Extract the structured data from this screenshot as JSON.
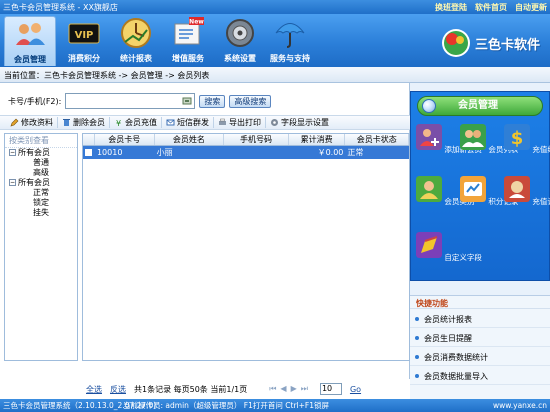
{
  "titlebar": {
    "title": "三色卡会员管理系统 - XX旗舰店",
    "links": [
      "换班登陆",
      "软件首页",
      "自动更新"
    ]
  },
  "toolbar": {
    "buttons": [
      {
        "label": "会员管理",
        "icon": "members-icon"
      },
      {
        "label": "消费积分",
        "icon": "vip-card-icon"
      },
      {
        "label": "统计报表",
        "icon": "report-clock-icon"
      },
      {
        "label": "增值服务",
        "icon": "new-service-icon"
      },
      {
        "label": "系统设置",
        "icon": "settings-icon"
      },
      {
        "label": "服务与支持",
        "icon": "umbrella-icon"
      }
    ],
    "brand": "三色卡软件"
  },
  "breadcrumb": "当前位置：三色卡会员管理系统 -> 会员管理 -> 会员列表",
  "search": {
    "label": "卡号/手机(F2):",
    "value": "",
    "search_btn": "搜索",
    "advanced_btn": "高级搜索"
  },
  "actions": [
    "修改资料",
    "删除会员",
    "会员充值",
    "短信群发",
    "导出打印",
    "字段显示设置"
  ],
  "tree": {
    "header": "按类别查看",
    "groups": [
      {
        "label": "所有会员",
        "children": [
          "普通",
          "高级"
        ]
      },
      {
        "label": "所有会员",
        "children": [
          "正常",
          "锁定",
          "挂失"
        ]
      }
    ]
  },
  "grid": {
    "columns": [
      "会员卡号",
      "会员姓名",
      "手机号码",
      "累计消费",
      "会员卡状态"
    ],
    "rows": [
      {
        "card": "10010",
        "name": "小丽",
        "phone": "",
        "total": "￥0.00",
        "status": "正常"
      }
    ]
  },
  "pager": {
    "select_all": "全选",
    "invert": "反选",
    "summary": "共1条记录  每页50条  当前1/1页",
    "page_value": "10",
    "go": "Go"
  },
  "side": {
    "title": "会员管理",
    "tiles": [
      {
        "label": "添加新会员",
        "icon": "add-member-icon"
      },
      {
        "label": "会员列表",
        "icon": "member-list-icon"
      },
      {
        "label": "充值续次",
        "icon": "dollar-icon"
      },
      {
        "label": "会员类别",
        "icon": "member-category-icon"
      },
      {
        "label": "积分记录",
        "icon": "points-record-icon"
      },
      {
        "label": "充值记录",
        "icon": "recharge-record-icon"
      },
      {
        "label": "自定义字段",
        "icon": "custom-field-icon"
      }
    ],
    "quick_title": "快捷功能",
    "quick": [
      "会员统计报表",
      "会员生日提醒",
      "会员消费数据统计",
      "会员数据批量导入"
    ]
  },
  "status": {
    "version": "三色卡会员管理系统（2.10.13.0_2.07.27.0）",
    "operator": "当前操作员: admin（超级管理员） F1打开首问 Ctrl+F1锁屏",
    "site": "www.yanxe.cn"
  }
}
